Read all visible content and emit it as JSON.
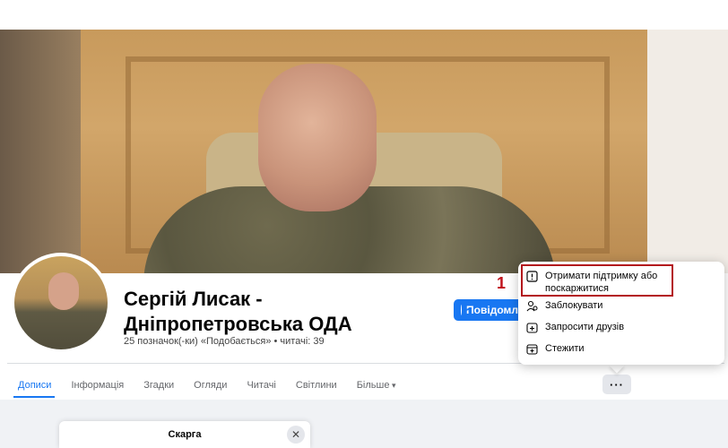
{
  "profile": {
    "name": "Сергій Лисак - Дніпропетровська ОДА",
    "meta": "25 позначок(-ки) «Подобається» • читачі: 39"
  },
  "actions": {
    "message_label": "Повідомлення",
    "more_label": "···"
  },
  "tabs": [
    {
      "label": "Дописи",
      "active": true
    },
    {
      "label": "Інформація"
    },
    {
      "label": "Згадки"
    },
    {
      "label": "Огляди"
    },
    {
      "label": "Читачі"
    },
    {
      "label": "Світлини"
    },
    {
      "label": "Більше"
    }
  ],
  "menu": {
    "items": [
      {
        "label": "Отримати підтримку або поскаржитися",
        "icon": "warning-icon"
      },
      {
        "label": "Заблокувати",
        "icon": "block-user-icon"
      },
      {
        "label": "Запросити друзів",
        "icon": "invite-icon"
      },
      {
        "label": "Стежити",
        "icon": "follow-icon"
      }
    ]
  },
  "annotation": {
    "step": "1"
  },
  "dialog": {
    "title": "Скарга",
    "close": "✕"
  },
  "colors": {
    "accent": "#1877f2",
    "highlight": "#b3131c"
  }
}
